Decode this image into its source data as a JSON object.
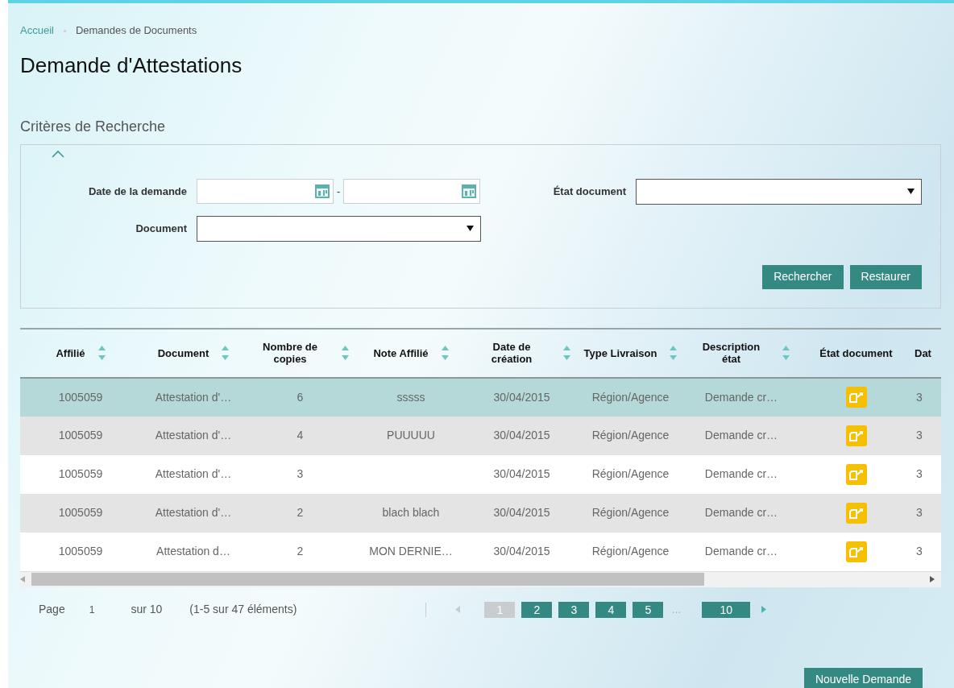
{
  "breadcrumb": [
    {
      "label": "Accueil",
      "kind": "link"
    },
    {
      "label": "Demandes de Documents",
      "kind": "current"
    }
  ],
  "title": "Demande d'Attestations",
  "search_criteria": {
    "heading": "Critères de Recherche",
    "expanded": true,
    "fields": [
      {
        "label": "Date de la demande",
        "kind": "date_range",
        "separator": "-"
      },
      {
        "label": "État document",
        "kind": "select"
      },
      {
        "label": "Document",
        "kind": "select"
      }
    ],
    "buttons": [
      "Rechercher",
      "Restaurer"
    ]
  },
  "table": {
    "columns": [
      {
        "label": "Affilié",
        "kind": "text",
        "sortable": true
      },
      {
        "label": "Document",
        "kind": "text",
        "sortable": true
      },
      {
        "label": "Nombre de copies",
        "kind": "text",
        "sortable": true
      },
      {
        "label": "Note Affilié",
        "kind": "text",
        "sortable": true
      },
      {
        "label": "Date de création",
        "kind": "text",
        "sortable": true
      },
      {
        "label": "Type Livraison",
        "kind": "text",
        "sortable": true
      },
      {
        "label": "Description état",
        "kind": "text",
        "sortable": true
      },
      {
        "label": "État document",
        "kind": "icon",
        "sortable": false
      },
      {
        "label": "Dat",
        "kind": "text",
        "sortable": false
      }
    ],
    "rows": [
      {
        "selected": true,
        "cells": [
          "1005059",
          "Attestation d'…",
          "6",
          "sssss",
          "30/04/2015",
          "Région/Agence",
          "Demande cr…",
          "3"
        ]
      },
      {
        "selected": false,
        "cells": [
          "1005059",
          "Attestation d'…",
          "4",
          "PUUUUU",
          "30/04/2015",
          "Région/Agence",
          "Demande cr…",
          "3"
        ]
      },
      {
        "selected": false,
        "cells": [
          "1005059",
          "Attestation d'…",
          "3",
          null,
          "30/04/2015",
          "Région/Agence",
          "Demande cr…",
          "3"
        ]
      },
      {
        "selected": false,
        "cells": [
          "1005059",
          "Attestation d'…",
          "2",
          "blach blach",
          "30/04/2015",
          "Région/Agence",
          "Demande cr…",
          "3"
        ]
      },
      {
        "selected": false,
        "cells": [
          "1005059",
          "Attestation d…",
          "2",
          "MON DERNIE…",
          "30/04/2015",
          "Région/Agence",
          "Demande cr…",
          "3"
        ]
      }
    ]
  },
  "pagination": {
    "page_label": "Page",
    "page": "1",
    "of": "sur 10",
    "summary": "(1-5 sur 47 éléments)",
    "prev_disabled": true,
    "next_disabled": false,
    "pages": [
      {
        "label": "1",
        "kind": "page",
        "selected": true
      },
      {
        "label": "2",
        "kind": "page",
        "selected": false
      },
      {
        "label": "3",
        "kind": "page",
        "selected": false
      },
      {
        "label": "4",
        "kind": "page",
        "selected": false
      },
      {
        "label": "5",
        "kind": "page",
        "selected": false
      },
      {
        "label": "…",
        "kind": "gap"
      },
      {
        "label": "10",
        "kind": "page",
        "selected": false
      }
    ]
  },
  "footer_button": "Nouvelle Demande"
}
